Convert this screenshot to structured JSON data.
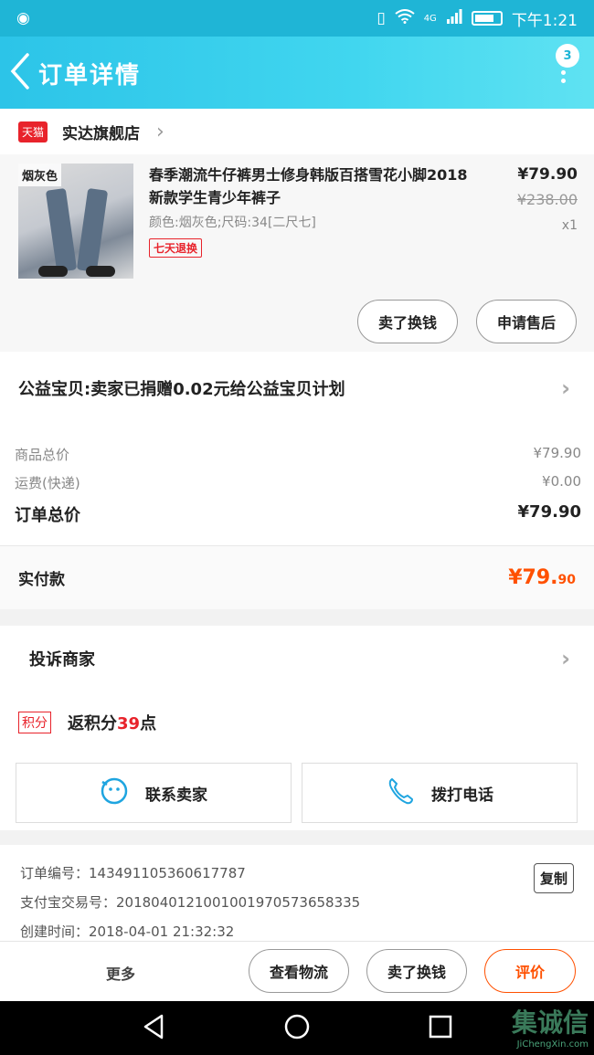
{
  "status_bar": {
    "signal_label": "4G",
    "time": "下午1:21"
  },
  "header": {
    "title": "订单详情",
    "badge_count": "3"
  },
  "shop": {
    "platform_badge": "天猫",
    "name": "实达旗舰店"
  },
  "product": {
    "image_tag": "烟灰色",
    "title": "春季潮流牛仔裤男士修身韩版百搭雪花小脚2018新款学生青少年裤子",
    "spec": "颜色:烟灰色;尺码:34[二尺七]",
    "service_tag": "七天退换",
    "price": "¥79.90",
    "original_price": "¥238.00",
    "quantity": "x1",
    "actions": [
      "卖了换钱",
      "申请售后"
    ]
  },
  "charity": {
    "text": "公益宝贝:卖家已捐赠0.02元给公益宝贝计划"
  },
  "summary": {
    "rows": [
      {
        "label": "商品总价",
        "value": "¥79.90"
      },
      {
        "label": "运费(快递)",
        "value": "¥0.00"
      },
      {
        "label": "订单总价",
        "value": "¥79.90"
      }
    ]
  },
  "paid": {
    "label": "实付款",
    "amount_main": "¥79.",
    "amount_cents": "90"
  },
  "complain": {
    "label": "投诉商家"
  },
  "points": {
    "badge": "积分",
    "prefix": "返积分",
    "count": "39",
    "suffix": "点"
  },
  "contact": {
    "seller": "联系卖家",
    "phone": "拨打电话"
  },
  "order_info": {
    "order_no": "订单编号：143491105360617787",
    "alipay_no": "支付宝交易号：2018040121001001970573658335",
    "created": "创建时间：2018-04-01 21:32:32",
    "copy_label": "复制"
  },
  "bottom_bar": {
    "more": "更多",
    "logistics": "查看物流",
    "sell": "卖了换钱",
    "review": "评价"
  },
  "watermark": {
    "brand": "集诚信",
    "site": "JiChengXin.com"
  },
  "colors": {
    "accent": "#1fb5d6",
    "price_red": "#ff5000",
    "tmall_red": "#e8232b"
  }
}
